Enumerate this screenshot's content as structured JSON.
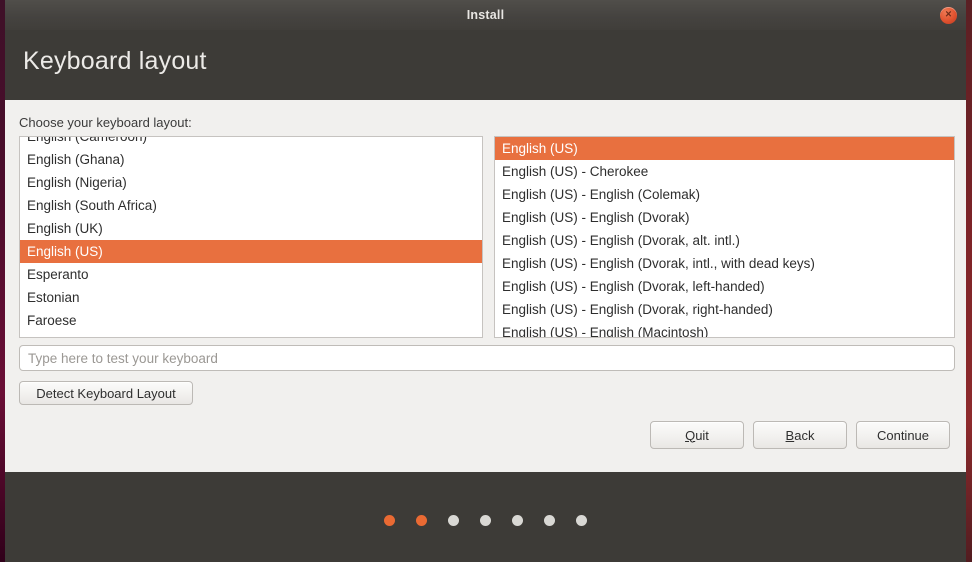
{
  "window": {
    "titlebar_title": "Install",
    "close_icon": "close-icon",
    "close_glyph": "×"
  },
  "header": {
    "page_title": "Keyboard layout"
  },
  "main": {
    "choose_label": "Choose your keyboard layout:",
    "layout_list": {
      "selected": "English (US)",
      "items": [
        "English (Cameroon)",
        "English (Ghana)",
        "English (Nigeria)",
        "English (South Africa)",
        "English (UK)",
        "English (US)",
        "Esperanto",
        "Estonian",
        "Faroese"
      ]
    },
    "variant_list": {
      "selected": "English (US)",
      "items": [
        "English (US)",
        "English (US) - Cherokee",
        "English (US) - English (Colemak)",
        "English (US) - English (Dvorak)",
        "English (US) - English (Dvorak, alt. intl.)",
        "English (US) - English (Dvorak, intl., with dead keys)",
        "English (US) - English (Dvorak, left-handed)",
        "English (US) - English (Dvorak, right-handed)",
        "English (US) - English (Macintosh)"
      ]
    },
    "test_input": {
      "value": "",
      "placeholder": "Type here to test your keyboard"
    },
    "detect_button": "Detect Keyboard Layout"
  },
  "nav": {
    "quit": {
      "mnemonic": "Q",
      "rest": "uit"
    },
    "back": {
      "mnemonic": "B",
      "rest": "ack"
    },
    "continue": "Continue"
  },
  "footer": {
    "dots": [
      true,
      true,
      false,
      false,
      false,
      false,
      false
    ]
  },
  "colors": {
    "accent_orange": "#e8703f",
    "dark_chrome": "#3d3b37",
    "content_bg": "#f1f0ee",
    "close_red": "#e0522f",
    "dot_inactive": "#d9d8d4"
  }
}
